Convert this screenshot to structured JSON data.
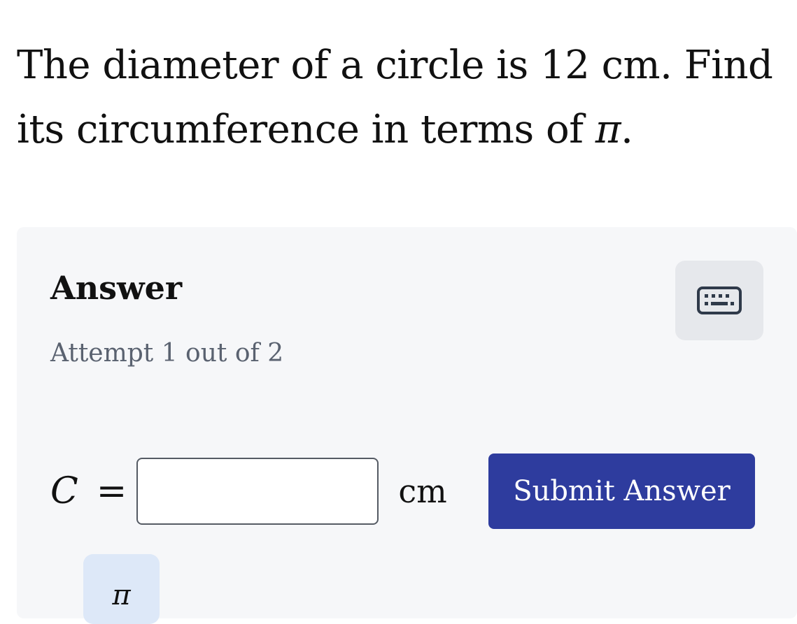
{
  "question": {
    "line1": "The diameter of a circle is 12 cm. Find",
    "line2_prefix": "its circumference in terms of ",
    "line2_symbol": "π",
    "line2_suffix": "."
  },
  "answer": {
    "title": "Answer",
    "attempt": "Attempt 1 out of 2",
    "keyboard_icon": "keyboard-icon",
    "variable": "C",
    "equals": "=",
    "input_value": "",
    "unit": "cm",
    "submit_label": "Submit Answer",
    "pi_button_label": "π"
  },
  "colors": {
    "panel_bg": "#f6f7f9",
    "submit_bg": "#2e3c9e",
    "keyboard_bg": "#e6e8ec",
    "pi_button_bg": "#dde8f8",
    "attempt_text": "#5a6270"
  }
}
